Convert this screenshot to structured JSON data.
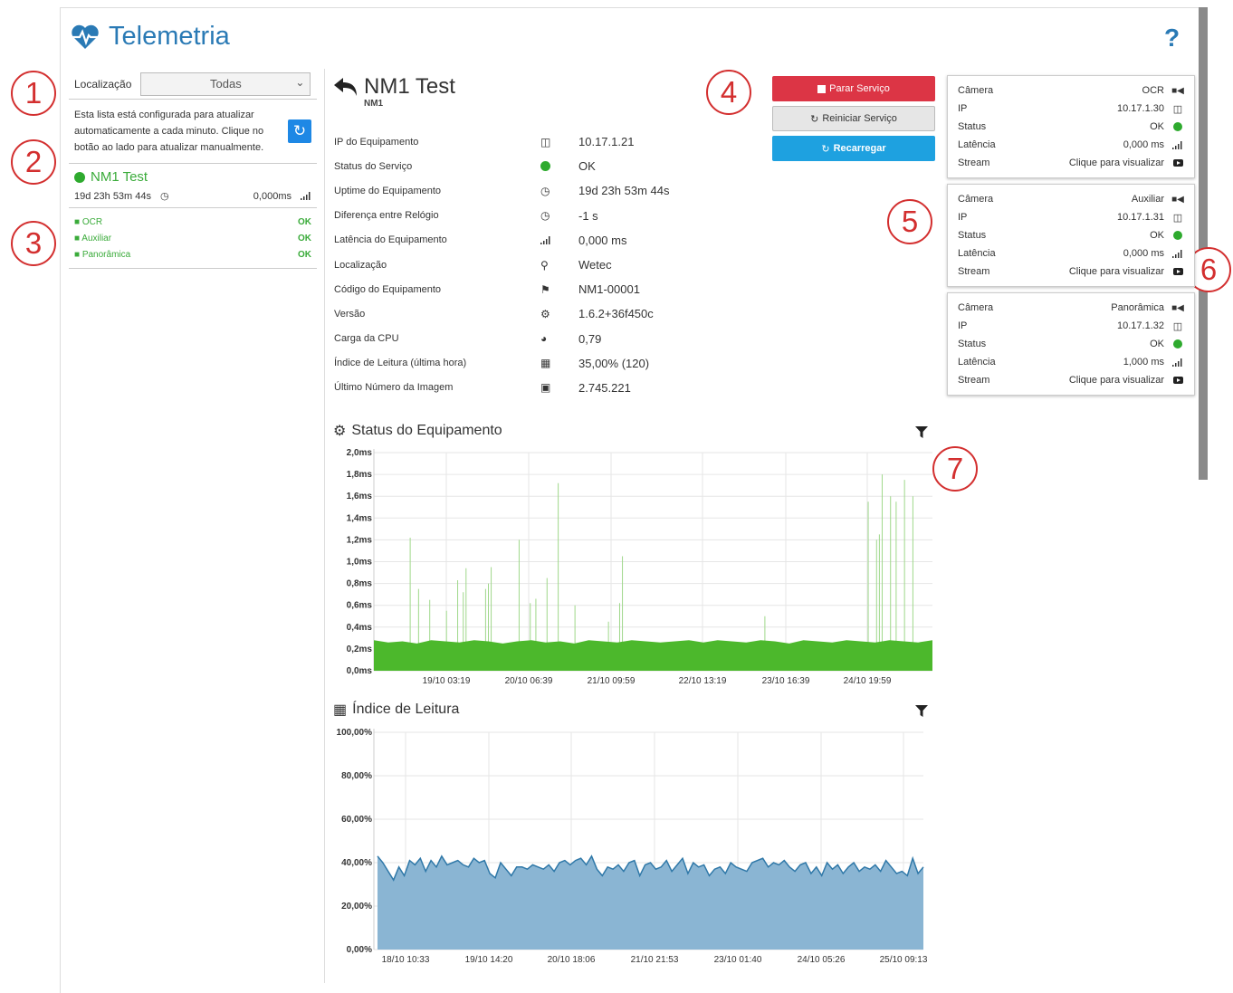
{
  "app": {
    "title": "Telemetria",
    "help": "?"
  },
  "annotations": [
    "1",
    "2",
    "3",
    "4",
    "5",
    "6",
    "7"
  ],
  "sidebar": {
    "location_label": "Localização",
    "location_value": "Todas",
    "info_text": "Esta lista está configurada para atualizar automaticamente a cada minuto. Clique no botão ao lado para atualizar manualmente.",
    "device": {
      "name": "NM1 Test",
      "uptime": "19d 23h 53m 44s",
      "latency": "0,000ms"
    },
    "cameras": [
      {
        "name": "OCR",
        "status": "OK"
      },
      {
        "name": "Auxiliar",
        "status": "OK"
      },
      {
        "name": "Panorâmica",
        "status": "OK"
      }
    ]
  },
  "device": {
    "title": "NM1 Test",
    "code": "NM1",
    "props": [
      {
        "label": "IP do Equipamento",
        "icon": "network-icon",
        "value": "10.17.1.21"
      },
      {
        "label": "Status do Serviço",
        "icon": "status-dot-icon",
        "value": "OK"
      },
      {
        "label": "Uptime do Equipamento",
        "icon": "clock-icon",
        "value": "19d 23h 53m 44s"
      },
      {
        "label": "Diferença entre Relógio",
        "icon": "clock-icon",
        "value": "-1 s"
      },
      {
        "label": "Latência do Equipamento",
        "icon": "signal-icon",
        "value": "0,000 ms"
      },
      {
        "label": "Localização",
        "icon": "map-marker-icon",
        "value": "Wetec"
      },
      {
        "label": "Código do Equipamento",
        "icon": "tag-icon",
        "value": "NM1-00001"
      },
      {
        "label": "Versão",
        "icon": "cogs-icon",
        "value": "1.6.2+36f450c"
      },
      {
        "label": "Carga da CPU",
        "icon": "dashboard-icon",
        "value": "0,79"
      },
      {
        "label": "Índice de Leitura (última hora)",
        "icon": "qrcode-icon",
        "value": "35,00% (120)"
      },
      {
        "label": "Último Número da Imagem",
        "icon": "image-icon",
        "value": "2.745.221"
      }
    ]
  },
  "actions": {
    "stop": "Parar Serviço",
    "restart": "Reiniciar Serviço",
    "reload": "Recarregar"
  },
  "camera_cards": [
    {
      "camera_label": "Câmera",
      "camera": "OCR",
      "ip_label": "IP",
      "ip": "10.17.1.30",
      "status_label": "Status",
      "status": "OK",
      "latency_label": "Latência",
      "latency": "0,000 ms",
      "stream_label": "Stream",
      "stream": "Clique para visualizar"
    },
    {
      "camera_label": "Câmera",
      "camera": "Auxiliar",
      "ip_label": "IP",
      "ip": "10.17.1.31",
      "status_label": "Status",
      "status": "OK",
      "latency_label": "Latência",
      "latency": "0,000 ms",
      "stream_label": "Stream",
      "stream": "Clique para visualizar"
    },
    {
      "camera_label": "Câmera",
      "camera": "Panorâmica",
      "ip_label": "IP",
      "ip": "10.17.1.32",
      "status_label": "Status",
      "status": "OK",
      "latency_label": "Latência",
      "latency": "1,000 ms",
      "stream_label": "Stream",
      "stream": "Clique para visualizar"
    }
  ],
  "charts": {
    "status_title": "Status do Equipamento",
    "reading_title": "Índice de Leitura"
  },
  "colors": {
    "brand": "#2a7ab5",
    "ok": "#2eaa2e",
    "danger": "#dc3545",
    "info": "#1ea1e0",
    "latency_fill": "#4cb82c",
    "reading_fill": "#8ab5d3",
    "reading_line": "#2f78a8"
  },
  "chart_data": [
    {
      "type": "area",
      "title": "Status do Equipamento",
      "y_tick_labels": [
        "0,0ms",
        "0,2ms",
        "0,4ms",
        "0,6ms",
        "0,8ms",
        "1,0ms",
        "1,2ms",
        "1,4ms",
        "1,6ms",
        "1,8ms",
        "2,0ms"
      ],
      "x_tick_labels": [
        "19/10 03:19",
        "20/10 06:39",
        "21/10 09:59",
        "22/10 13:19",
        "23/10 16:39",
        "24/10 19:59"
      ],
      "ylim": [
        0,
        2.0
      ],
      "series": [
        {
          "baseline_ms": [
            0.28,
            0.26,
            0.27,
            0.25,
            0.28,
            0.27,
            0.26,
            0.28,
            0.27,
            0.25,
            0.27,
            0.28,
            0.26,
            0.27,
            0.25,
            0.28,
            0.27,
            0.26,
            0.28,
            0.27,
            0.26,
            0.27,
            0.28,
            0.26,
            0.28,
            0.27,
            0.26,
            0.28,
            0.27,
            0.25,
            0.28,
            0.27,
            0.26,
            0.28,
            0.27,
            0.26,
            0.28,
            0.27,
            0.26,
            0.28
          ],
          "spikes": [
            {
              "t": 0.065,
              "v": 1.22
            },
            {
              "t": 0.08,
              "v": 0.75
            },
            {
              "t": 0.1,
              "v": 0.65
            },
            {
              "t": 0.13,
              "v": 0.55
            },
            {
              "t": 0.15,
              "v": 0.83
            },
            {
              "t": 0.16,
              "v": 0.72
            },
            {
              "t": 0.165,
              "v": 0.94
            },
            {
              "t": 0.2,
              "v": 0.75
            },
            {
              "t": 0.205,
              "v": 0.8
            },
            {
              "t": 0.21,
              "v": 0.95
            },
            {
              "t": 0.26,
              "v": 1.2
            },
            {
              "t": 0.28,
              "v": 0.62
            },
            {
              "t": 0.29,
              "v": 0.66
            },
            {
              "t": 0.31,
              "v": 0.85
            },
            {
              "t": 0.33,
              "v": 1.72
            },
            {
              "t": 0.36,
              "v": 0.6
            },
            {
              "t": 0.42,
              "v": 0.45
            },
            {
              "t": 0.44,
              "v": 0.62
            },
            {
              "t": 0.445,
              "v": 1.05
            },
            {
              "t": 0.7,
              "v": 0.5
            },
            {
              "t": 0.885,
              "v": 1.55
            },
            {
              "t": 0.9,
              "v": 1.2
            },
            {
              "t": 0.905,
              "v": 1.25
            },
            {
              "t": 0.91,
              "v": 1.8
            },
            {
              "t": 0.925,
              "v": 1.6
            },
            {
              "t": 0.935,
              "v": 1.55
            },
            {
              "t": 0.95,
              "v": 1.75
            },
            {
              "t": 0.965,
              "v": 1.6
            }
          ]
        }
      ]
    },
    {
      "type": "area",
      "title": "Índice de Leitura",
      "y_tick_labels": [
        "0,00%",
        "20,00%",
        "40,00%",
        "60,00%",
        "80,00%",
        "100,00%"
      ],
      "x_tick_labels": [
        "18/10 10:33",
        "19/10 14:20",
        "20/10 18:06",
        "21/10 21:53",
        "23/10 01:40",
        "24/10 05:26",
        "25/10 09:13"
      ],
      "ylim": [
        0,
        100
      ],
      "series": [
        {
          "values": [
            43,
            40,
            36,
            32,
            38,
            34,
            41,
            39,
            42,
            36,
            41,
            38,
            43,
            39,
            40,
            41,
            39,
            38,
            42,
            40,
            41,
            35,
            33,
            40,
            37,
            34,
            38,
            38,
            37,
            39,
            38,
            37,
            39,
            36,
            40,
            41,
            39,
            41,
            42,
            39,
            43,
            37,
            34,
            38,
            37,
            39,
            36,
            40,
            41,
            34,
            39,
            40,
            37,
            38,
            41,
            36,
            39,
            42,
            35,
            40,
            38,
            39,
            34,
            37,
            38,
            35,
            40,
            38,
            37,
            36,
            40,
            41,
            42,
            38,
            40,
            39,
            41,
            38,
            36,
            39,
            40,
            35,
            38,
            34,
            40,
            37,
            39,
            35,
            38,
            40,
            36,
            38,
            37,
            39,
            36,
            41,
            38,
            35,
            36,
            34,
            42,
            35,
            38
          ]
        }
      ]
    }
  ]
}
